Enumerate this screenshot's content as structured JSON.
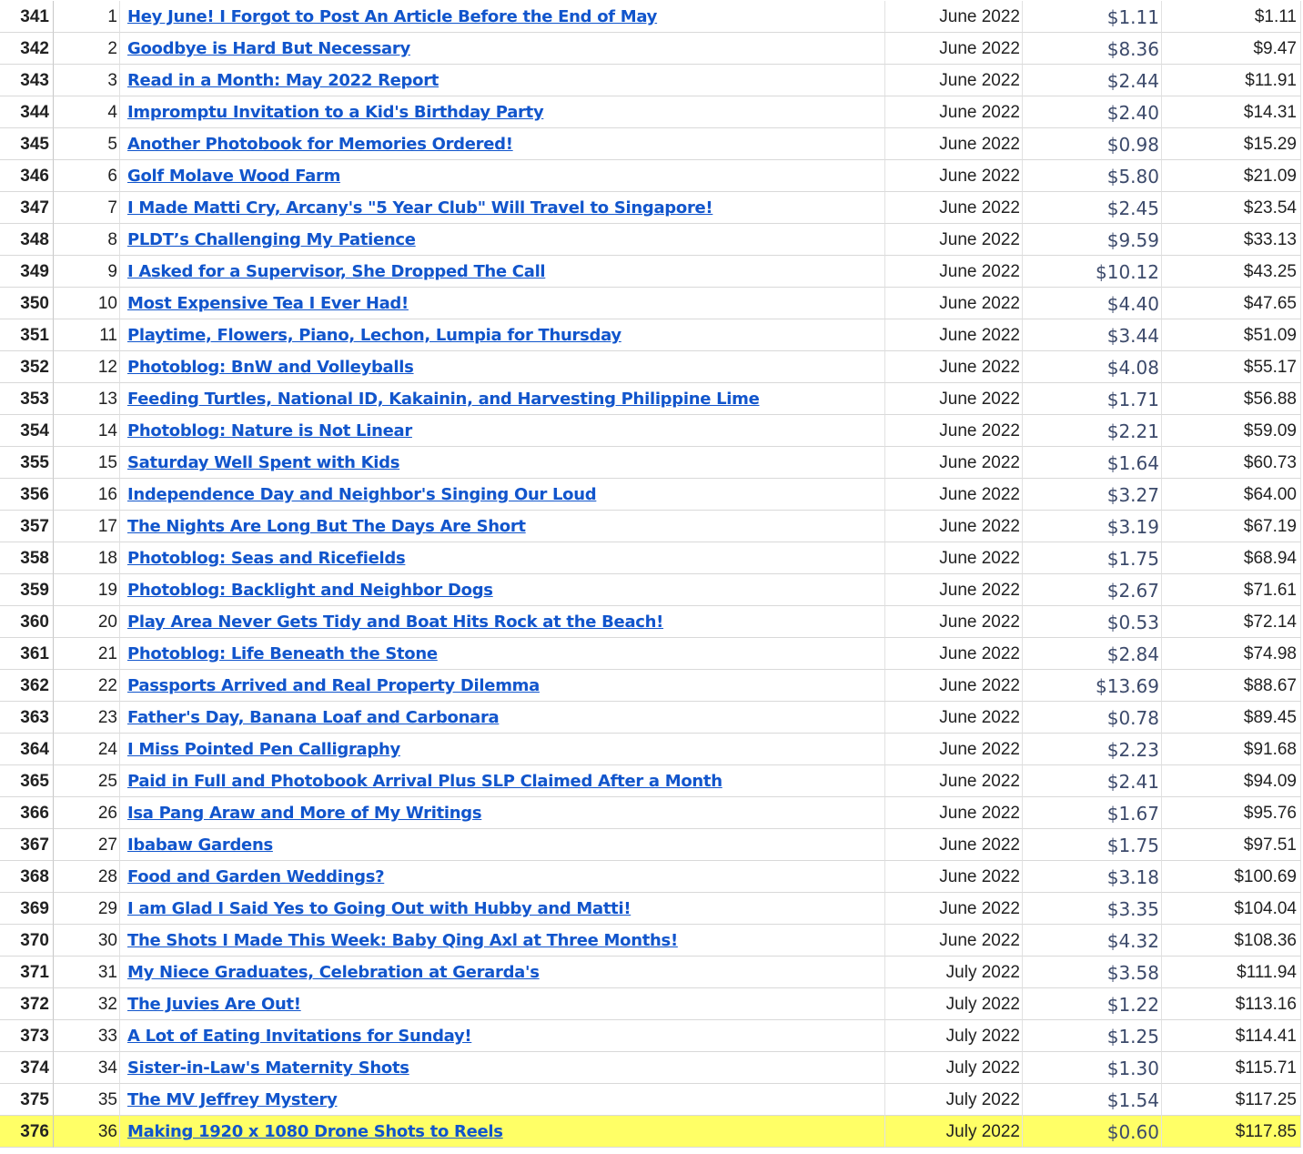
{
  "sheet": {
    "highlight_color": "#ffff66",
    "link_color": "#1155cc",
    "rows": [
      {
        "row": "341",
        "n": "1",
        "title": "Hey June! I Forgot to Post An Article Before the End of May",
        "month": "June 2022",
        "earn": "$1.11",
        "total": "$1.11"
      },
      {
        "row": "342",
        "n": "2",
        "title": "Goodbye is Hard But Necessary",
        "month": "June 2022",
        "earn": "$8.36",
        "total": "$9.47"
      },
      {
        "row": "343",
        "n": "3",
        "title": "Read in a Month: May 2022 Report",
        "month": "June 2022",
        "earn": "$2.44",
        "total": "$11.91"
      },
      {
        "row": "344",
        "n": "4",
        "title": "Impromptu Invitation to a Kid's Birthday Party",
        "month": "June 2022",
        "earn": "$2.40",
        "total": "$14.31"
      },
      {
        "row": "345",
        "n": "5",
        "title": "Another Photobook for Memories Ordered!",
        "month": "June 2022",
        "earn": "$0.98",
        "total": "$15.29"
      },
      {
        "row": "346",
        "n": "6",
        "title": "Golf Molave Wood Farm",
        "month": "June 2022",
        "earn": "$5.80",
        "total": "$21.09"
      },
      {
        "row": "347",
        "n": "7",
        "title": "I Made Matti Cry, Arcany's \"5 Year Club\" Will Travel to Singapore!",
        "month": "June 2022",
        "earn": "$2.45",
        "total": "$23.54"
      },
      {
        "row": "348",
        "n": "8",
        "title": "PLDT’s Challenging My Patience",
        "month": "June 2022",
        "earn": "$9.59",
        "total": "$33.13"
      },
      {
        "row": "349",
        "n": "9",
        "title": "I Asked for a Supervisor, She Dropped The Call",
        "month": "June 2022",
        "earn": "$10.12",
        "total": "$43.25"
      },
      {
        "row": "350",
        "n": "10",
        "title": "Most Expensive Tea I Ever Had!",
        "month": "June 2022",
        "earn": "$4.40",
        "total": "$47.65"
      },
      {
        "row": "351",
        "n": "11",
        "title": "Playtime, Flowers, Piano, Lechon, Lumpia for Thursday",
        "month": "June 2022",
        "earn": "$3.44",
        "total": "$51.09"
      },
      {
        "row": "352",
        "n": "12",
        "title": "Photoblog: BnW and Volleyballs",
        "month": "June 2022",
        "earn": "$4.08",
        "total": "$55.17"
      },
      {
        "row": "353",
        "n": "13",
        "title": "Feeding Turtles, National ID, Kakainin, and Harvesting Philippine Lime",
        "month": "June 2022",
        "earn": "$1.71",
        "total": "$56.88"
      },
      {
        "row": "354",
        "n": "14",
        "title": "Photoblog: Nature is Not Linear",
        "month": "June 2022",
        "earn": "$2.21",
        "total": "$59.09"
      },
      {
        "row": "355",
        "n": "15",
        "title": "Saturday Well Spent with Kids",
        "month": "June 2022",
        "earn": "$1.64",
        "total": "$60.73"
      },
      {
        "row": "356",
        "n": "16",
        "title": "Independence Day and Neighbor's Singing Our Loud",
        "month": "June 2022",
        "earn": "$3.27",
        "total": "$64.00"
      },
      {
        "row": "357",
        "n": "17",
        "title": "The Nights Are Long But The Days Are Short",
        "month": "June 2022",
        "earn": "$3.19",
        "total": "$67.19"
      },
      {
        "row": "358",
        "n": "18",
        "title": "Photoblog: Seas and Ricefields",
        "month": "June 2022",
        "earn": "$1.75",
        "total": "$68.94"
      },
      {
        "row": "359",
        "n": "19",
        "title": "Photoblog: Backlight and Neighbor Dogs",
        "month": "June 2022",
        "earn": "$2.67",
        "total": "$71.61"
      },
      {
        "row": "360",
        "n": "20",
        "title": "Play Area Never Gets Tidy and Boat Hits Rock at the Beach!",
        "month": "June 2022",
        "earn": "$0.53",
        "total": "$72.14"
      },
      {
        "row": "361",
        "n": "21",
        "title": "Photoblog: Life Beneath the Stone",
        "month": "June 2022",
        "earn": "$2.84",
        "total": "$74.98"
      },
      {
        "row": "362",
        "n": "22",
        "title": "Passports Arrived and Real Property Dilemma",
        "month": "June 2022",
        "earn": "$13.69",
        "total": "$88.67"
      },
      {
        "row": "363",
        "n": "23",
        "title": "Father's Day, Banana Loaf and Carbonara",
        "month": "June 2022",
        "earn": "$0.78",
        "total": "$89.45"
      },
      {
        "row": "364",
        "n": "24",
        "title": "I Miss Pointed Pen Calligraphy",
        "month": "June 2022",
        "earn": "$2.23",
        "total": "$91.68"
      },
      {
        "row": "365",
        "n": "25",
        "title": "Paid in Full and Photobook Arrival Plus SLP Claimed After a Month",
        "month": "June 2022",
        "earn": "$2.41",
        "total": "$94.09"
      },
      {
        "row": "366",
        "n": "26",
        "title": "Isa Pang Araw and More of My Writings",
        "month": "June 2022",
        "earn": "$1.67",
        "total": "$95.76"
      },
      {
        "row": "367",
        "n": "27",
        "title": "Ibabaw Gardens",
        "month": "June 2022",
        "earn": "$1.75",
        "total": "$97.51"
      },
      {
        "row": "368",
        "n": "28",
        "title": "Food and Garden Weddings?",
        "month": "June 2022",
        "earn": "$3.18",
        "total": "$100.69"
      },
      {
        "row": "369",
        "n": "29",
        "title": "I am Glad I Said Yes to Going Out with Hubby and Matti!",
        "month": "June 2022",
        "earn": "$3.35",
        "total": "$104.04"
      },
      {
        "row": "370",
        "n": "30",
        "title": "The Shots I Made This Week: Baby Qing Axl at Three Months!",
        "month": "June 2022",
        "earn": "$4.32",
        "total": "$108.36"
      },
      {
        "row": "371",
        "n": "31",
        "title": "My Niece Graduates, Celebration at Gerarda's",
        "month": "July 2022",
        "earn": "$3.58",
        "total": "$111.94"
      },
      {
        "row": "372",
        "n": "32",
        "title": "The Juvies Are Out!",
        "month": "July 2022",
        "earn": "$1.22",
        "total": "$113.16"
      },
      {
        "row": "373",
        "n": "33",
        "title": "A Lot of Eating Invitations for Sunday!",
        "month": "July 2022",
        "earn": "$1.25",
        "total": "$114.41"
      },
      {
        "row": "374",
        "n": "34",
        "title": "Sister-in-Law's Maternity Shots",
        "month": "July 2022",
        "earn": "$1.30",
        "total": "$115.71"
      },
      {
        "row": "375",
        "n": "35",
        "title": "The MV Jeffrey Mystery",
        "month": "July 2022",
        "earn": "$1.54",
        "total": "$117.25"
      },
      {
        "row": "376",
        "n": "36",
        "title": "Making 1920 x 1080 Drone Shots to Reels",
        "month": "July 2022",
        "earn": "$0.60",
        "total": "$117.85",
        "highlighted": true
      }
    ]
  }
}
